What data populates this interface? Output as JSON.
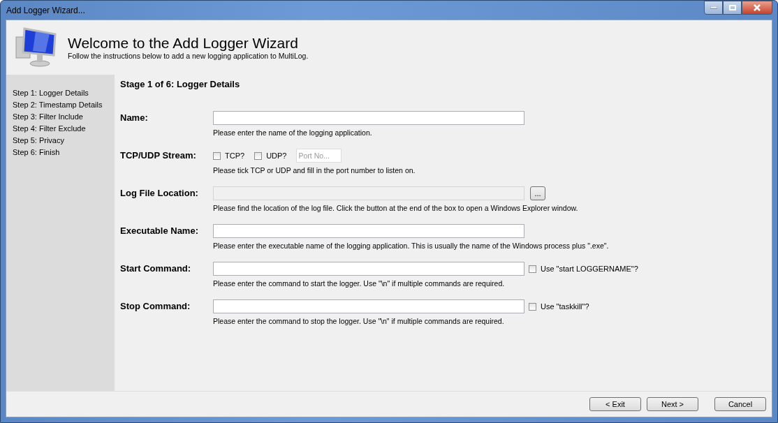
{
  "window": {
    "title": "Add Logger Wizard..."
  },
  "header": {
    "title": "Welcome to the Add Logger Wizard",
    "subtitle": "Follow the instructions below to add a new logging application to MultiLog."
  },
  "sidebar": {
    "items": [
      {
        "label": "Step 1: Logger Details"
      },
      {
        "label": "Step 2: Timestamp Details"
      },
      {
        "label": "Step 3: Filter Include"
      },
      {
        "label": "Step 4: Filter Exclude"
      },
      {
        "label": "Step 5: Privacy"
      },
      {
        "label": "Step 6: Finish"
      }
    ]
  },
  "stage_title": "Stage 1 of 6: Logger Details",
  "fields": [
    {
      "kind": "text",
      "label": "Name:",
      "disabled": false,
      "hint": "Please enter the name of the logging application."
    },
    {
      "kind": "checks",
      "label": "TCP/UDP Stream:",
      "checks": [
        {
          "label": "TCP?",
          "checked": false
        },
        {
          "label": "UDP?",
          "checked": false
        }
      ],
      "port_placeholder": "Port No...",
      "hint": "Please tick TCP or UDP and fill in the port number to listen on."
    },
    {
      "kind": "browse",
      "label": "Log File Location:",
      "disabled": true,
      "button": "...",
      "hint": "Please find the location of the log file. Click the button at the end of the box to open a Windows Explorer window."
    },
    {
      "kind": "text",
      "label": "Executable Name:",
      "disabled": false,
      "hint": "Please enter the executable name of the logging application. This is usually the name of the Windows process plus \".exe\"."
    },
    {
      "kind": "option",
      "label": "Start Command:",
      "disabled": false,
      "option": {
        "label": "Use \"start LOGGERNAME\"?",
        "checked": false
      },
      "hint": "Please enter the command to start the logger. Use \"\\n\" if multiple commands are required."
    },
    {
      "kind": "option",
      "label": "Stop Command:",
      "disabled": false,
      "option": {
        "label": "Use \"taskkill\"?",
        "checked": false
      },
      "hint": "Please enter the command to stop the logger. Use \"\\n\" if multiple commands are required."
    }
  ],
  "buttons": [
    "< Exit",
    "Next >",
    "Cancel"
  ]
}
